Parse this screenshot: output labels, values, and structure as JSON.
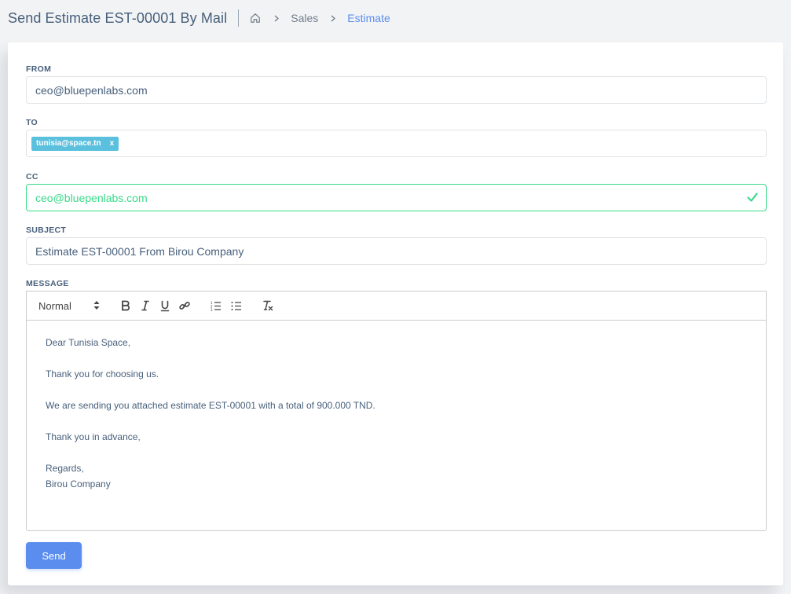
{
  "header": {
    "title": "Send Estimate EST-00001 By Mail",
    "breadcrumb": [
      "Sales",
      "Estimate"
    ]
  },
  "form": {
    "from_label": "FROM",
    "from_value": "ceo@bluepenlabs.com",
    "to_label": "TO",
    "to_tag": "tunisia@space.tn",
    "to_tag_remove": "x",
    "cc_label": "CC",
    "cc_value": "ceo@bluepenlabs.com",
    "subject_label": "SUBJECT",
    "subject_value": "Estimate EST-00001 From Birou Company",
    "message_label": "MESSAGE",
    "toolbar": {
      "format": "Normal"
    },
    "message_lines": [
      "Dear Tunisia Space,",
      "",
      "Thank you for choosing us.",
      "",
      "We are sending you attached estimate EST-00001 with a total of 900.000 TND.",
      "",
      "Thank you in advance,",
      "",
      "Regards,",
      "Birou Company"
    ],
    "send_label": "Send"
  },
  "colors": {
    "primary": "#5a8dee",
    "success": "#39da8a",
    "tag": "#5bc0de"
  }
}
